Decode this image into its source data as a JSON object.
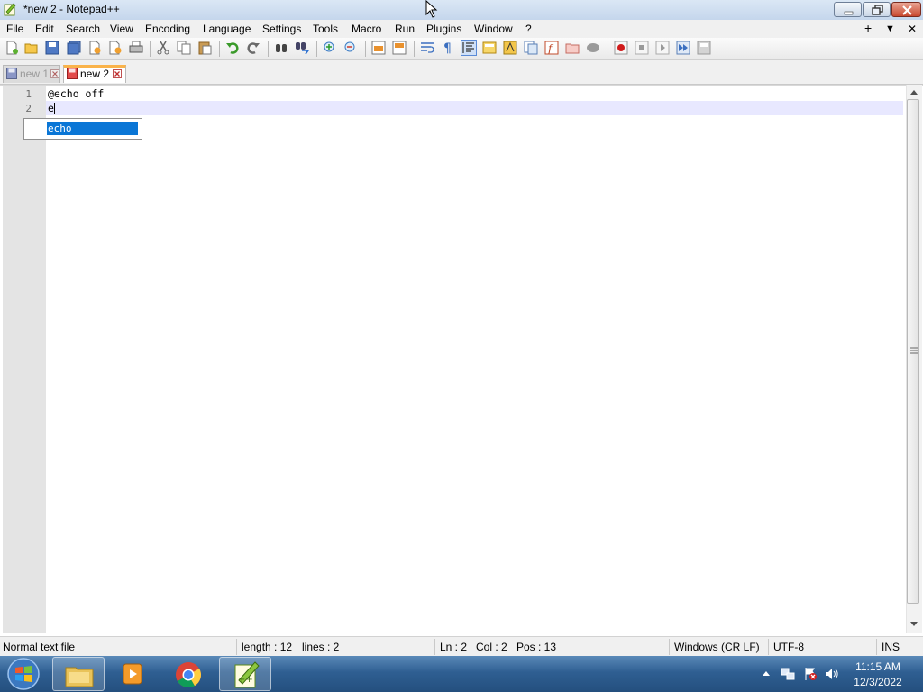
{
  "window": {
    "title": "*new 2 - Notepad++"
  },
  "menu": {
    "items": [
      "File",
      "Edit",
      "Search",
      "View",
      "Encoding",
      "Language",
      "Settings",
      "Tools",
      "Macro",
      "Run",
      "Plugins",
      "Window",
      "?"
    ],
    "right": {
      "add": "+",
      "dropdown": "▼",
      "close": "✕"
    }
  },
  "tabs": [
    {
      "label": "new 1",
      "active": false
    },
    {
      "label": "new 2",
      "active": true
    }
  ],
  "editor": {
    "line_numbers": [
      "1",
      "2"
    ],
    "lines": [
      "@echo off",
      "e"
    ]
  },
  "autocomplete": {
    "items": [
      "echo"
    ],
    "selected": "echo"
  },
  "status": {
    "file_type": "Normal text file",
    "length": "length : 12",
    "lines": "lines : 2",
    "ln": "Ln : 2",
    "col": "Col : 2",
    "pos": "Pos : 13",
    "eol": "Windows (CR LF)",
    "encoding": "UTF-8",
    "mode": "INS"
  },
  "taskbar": {
    "apps": [
      "windows-explorer-icon",
      "media-player-icon",
      "chrome-icon",
      "notepad-plus-plus-icon"
    ],
    "time": "11:15 AM",
    "date": "12/3/2022"
  },
  "colors": {
    "autocomplete_highlight": "#0a76d6",
    "current_line": "#e8e8ff",
    "active_tab_accent": "#fab34a"
  }
}
